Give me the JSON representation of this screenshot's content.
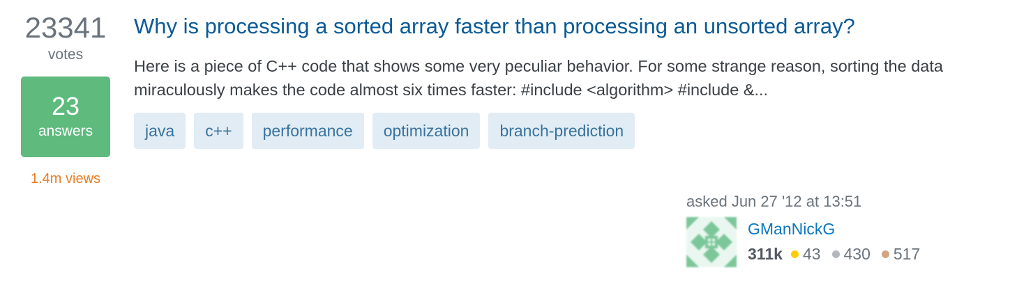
{
  "stats": {
    "votes": "23341",
    "votes_label": "votes",
    "answers": "23",
    "answers_label": "answers",
    "views": "1.4m views"
  },
  "question": {
    "title": "Why is processing a sorted array faster than processing an unsorted array?",
    "excerpt": "Here is a piece of C++ code that shows some very peculiar behavior. For some strange reason, sorting the data miraculously makes the code almost six times faster: #include <algorithm> #include &...",
    "tags": [
      "java",
      "c++",
      "performance",
      "optimization",
      "branch-prediction"
    ]
  },
  "owner": {
    "asked": "asked Jun 27 '12 at 13:51",
    "name": "GManNickG",
    "reputation": "311k",
    "badges": [
      {
        "kind": "gold",
        "count": "43",
        "color": "#ffcc01"
      },
      {
        "kind": "silver",
        "count": "430",
        "color": "#b4b8bc"
      },
      {
        "kind": "bronze",
        "count": "517",
        "color": "#d1a684"
      }
    ]
  },
  "colors": {
    "accepted_answers_bg": "#5eba7d",
    "title_link": "#0a5a96",
    "tag_bg": "#e1ecf4",
    "tag_text": "#39739d",
    "views": "#e87c26"
  }
}
